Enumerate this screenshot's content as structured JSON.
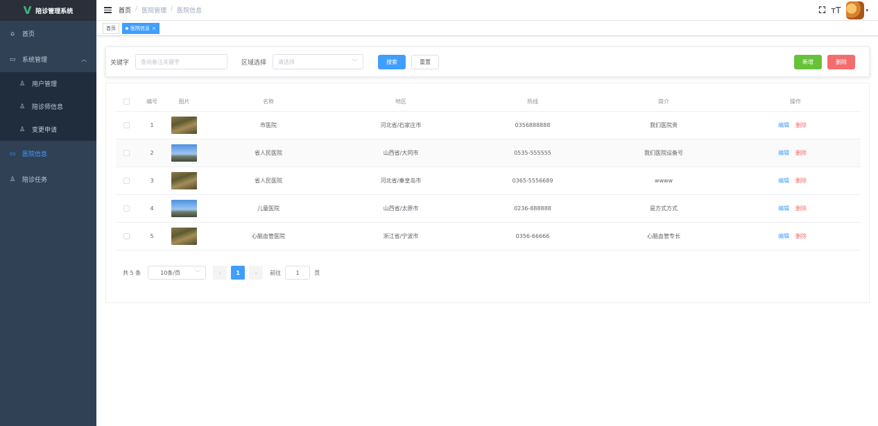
{
  "app": {
    "title": "陪诊管理系统"
  },
  "sidebar": {
    "items": [
      {
        "label": "首页",
        "icon": "home-icon"
      },
      {
        "label": "系统管理",
        "icon": "monitor-icon",
        "expanded": true
      },
      {
        "label": "用户管理",
        "icon": "user-icon"
      },
      {
        "label": "陪诊师信息",
        "icon": "users-icon"
      },
      {
        "label": "变更申请",
        "icon": "user-icon"
      },
      {
        "label": "医院信息",
        "icon": "monitor-icon",
        "active": true
      },
      {
        "label": "陪诊任务",
        "icon": "users-icon"
      }
    ]
  },
  "header": {
    "breadcrumb": [
      "首页",
      "医院管理",
      "医院信息"
    ]
  },
  "tags": [
    {
      "label": "首页",
      "active": false
    },
    {
      "label": "医院信息",
      "active": true,
      "close": "×"
    }
  ],
  "search": {
    "keyword_label": "关键字",
    "keyword_placeholder": "查询备注关键字",
    "region_label": "区域选择",
    "region_placeholder": "请选择",
    "search_button": "搜索",
    "reset_button": "重置",
    "add_button": "新增",
    "delete_button": "删除"
  },
  "table": {
    "columns": [
      "编号",
      "图片",
      "名称",
      "地区",
      "热线",
      "简介",
      "操作"
    ],
    "rows": [
      {
        "id": "1",
        "image": "desert",
        "name": "市医院",
        "region": "河北省/石家庄市",
        "hotline": "0356888888",
        "intro": "我们医院贵"
      },
      {
        "id": "2",
        "image": "sky",
        "name": "省人民医院",
        "region": "山西省/大同市",
        "hotline": "0535-555555",
        "intro": "我们医院设备号"
      },
      {
        "id": "3",
        "image": "desert",
        "name": "省人民医院",
        "region": "河北省/秦皇岛市",
        "hotline": "0365-5556689",
        "intro": "wwww"
      },
      {
        "id": "4",
        "image": "sky",
        "name": "儿童医院",
        "region": "山西省/太原市",
        "hotline": "0236-888888",
        "intro": "是方式方式"
      },
      {
        "id": "5",
        "image": "desert",
        "name": "心脑血管医院",
        "region": "浙江省/宁波市",
        "hotline": "0356-66666",
        "intro": "心脑血管专长"
      }
    ],
    "actions": {
      "edit": "编辑",
      "delete": "删除"
    }
  },
  "pagination": {
    "total": "共 5 条",
    "page_size": "10条/页",
    "prev": "‹",
    "current": "1",
    "next": "›",
    "goto_label": "前往",
    "goto_value": "1",
    "goto_suffix": "页"
  },
  "colors": {
    "primary": "#409eff",
    "success": "#67c23a",
    "danger": "#f56c6c",
    "sidebar": "#304156"
  }
}
